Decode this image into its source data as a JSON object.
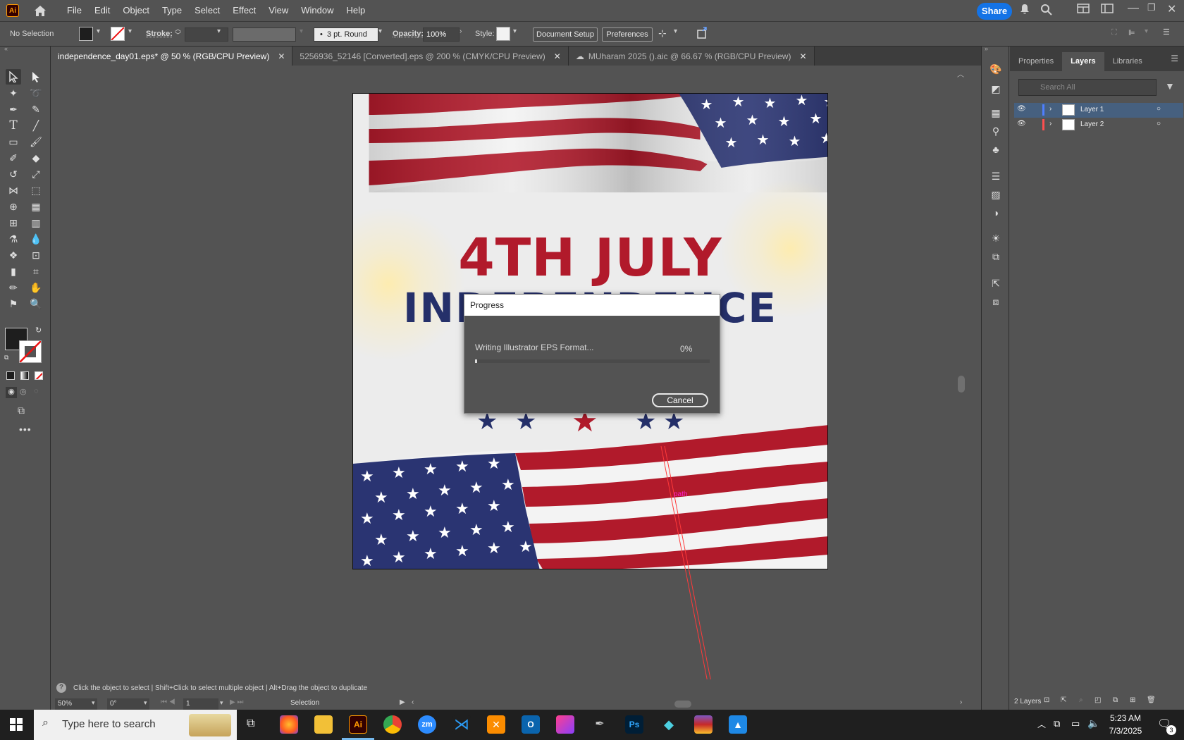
{
  "app": {
    "logo_text": "Ai"
  },
  "menu": [
    "File",
    "Edit",
    "Object",
    "Type",
    "Select",
    "Effect",
    "View",
    "Window",
    "Help"
  ],
  "share_label": "Share",
  "control_bar": {
    "selection": "No Selection",
    "stroke_label": "Stroke:",
    "brush": "3 pt. Round",
    "opacity_label": "Opacity:",
    "opacity_value": "100%",
    "style_label": "Style:",
    "document_setup": "Document Setup",
    "preferences": "Preferences"
  },
  "tabs": [
    {
      "label": "independence_day01.eps* @ 50 % (RGB/CPU Preview)"
    },
    {
      "label": "5256936_52146 [Converted].eps @ 200 % (CMYK/CPU Preview)"
    },
    {
      "label": "MUharam 2025 ().aic @ 66.67 % (RGB/CPU Preview)"
    }
  ],
  "artwork": {
    "headline": "4TH JULY",
    "subheadline": "INDEPENDENCE",
    "path_label": "path"
  },
  "dialog": {
    "title": "Progress",
    "message": "Writing Illustrator EPS Format...",
    "percent_text": "0%",
    "progress": 0.01,
    "cancel": "Cancel"
  },
  "panel": {
    "tabs": [
      "Properties",
      "Layers",
      "Libraries"
    ],
    "search_placeholder": "Search All",
    "layers": [
      {
        "name": "Layer 1",
        "color": "#4f7fff"
      },
      {
        "name": "Layer 2",
        "color": "#ff4f4f"
      }
    ],
    "footer": "2 Layers"
  },
  "status": {
    "hint": "Click the object to select  |  Shift+Click to select multiple object  |  Alt+Drag the object to duplicate",
    "zoom": "50%",
    "rotation": "0°",
    "artboard": "1",
    "tool": "Selection"
  },
  "taskbar": {
    "search_placeholder": "Type here to search",
    "time": "5:23 AM",
    "date": "7/3/2025",
    "notifications": "3"
  },
  "colors": {
    "accent": "#1473e6",
    "flag_red": "#b11a2b",
    "flag_blue": "#25306a"
  }
}
